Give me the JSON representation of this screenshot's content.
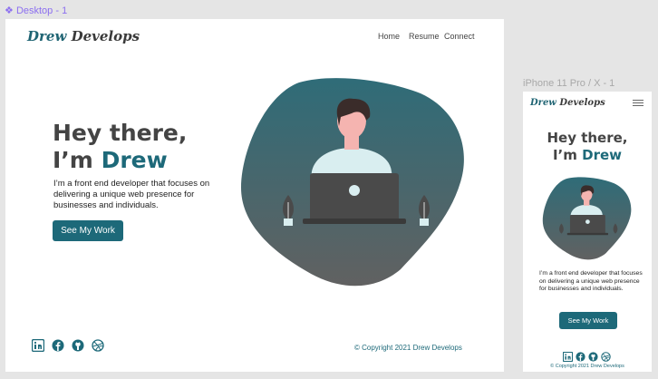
{
  "frames": {
    "desktop_label": "Desktop - 1",
    "phone_label": "iPhone 11 Pro / X - 1"
  },
  "site": {
    "logo_first": "Drew",
    "logo_second": "Develops",
    "nav": [
      "Home",
      "Resume",
      "Connect"
    ],
    "headline_line1": "Hey there,",
    "headline_prefix": "I’m",
    "headline_name": "Drew",
    "intro": "I’m a front end developer that focuses on delivering a unique web presence for businesses and individuals.",
    "cta": "See My Work",
    "copyright": "© Copyright 2021 Drew Develops",
    "social_icons": [
      "linkedin-icon",
      "facebook-icon",
      "github-icon",
      "dribbble-icon"
    ]
  },
  "colors": {
    "accent": "#1d6979",
    "blob_top": "#2f6c78",
    "blob_bottom": "#616161",
    "frame_label": "#8c6ff0"
  }
}
